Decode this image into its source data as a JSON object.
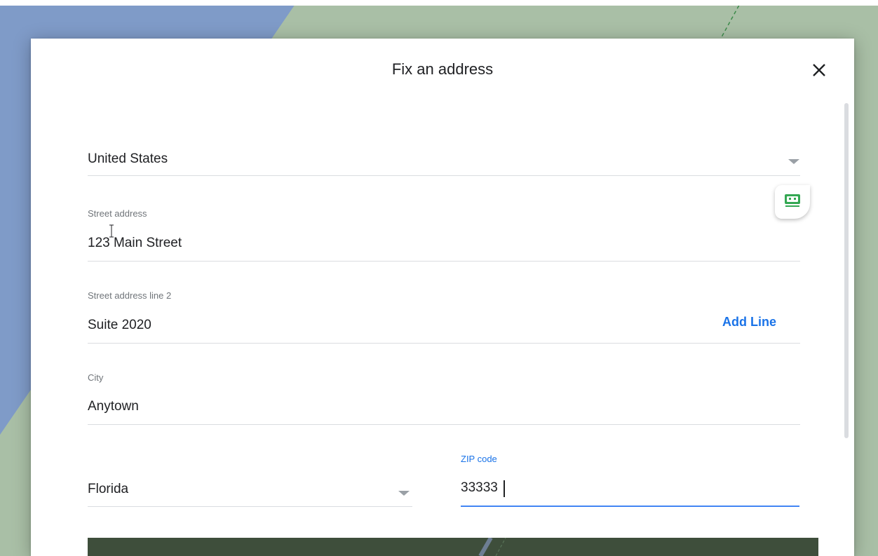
{
  "dialog": {
    "title": "Fix an address"
  },
  "fields": {
    "country": {
      "value": "United States"
    },
    "street": {
      "label": "Street address",
      "value": "123 Main Street"
    },
    "street2": {
      "label": "Street address line 2",
      "value": "Suite 2020",
      "add_line_label": "Add Line"
    },
    "city": {
      "label": "City",
      "value": "Anytown"
    },
    "state": {
      "value": "Florida"
    },
    "zip": {
      "label": "ZIP code",
      "value": "33333"
    }
  },
  "colors": {
    "accent": "#1a73e8",
    "focus_underline": "#4285f4",
    "divider": "#dadce0",
    "label": "#70757a",
    "text": "#202124",
    "badge_green": "#34a853"
  },
  "icons": {
    "close": "close-icon",
    "dropdown": "chevron-down-icon",
    "assistant": "keyboard-assist-icon"
  }
}
